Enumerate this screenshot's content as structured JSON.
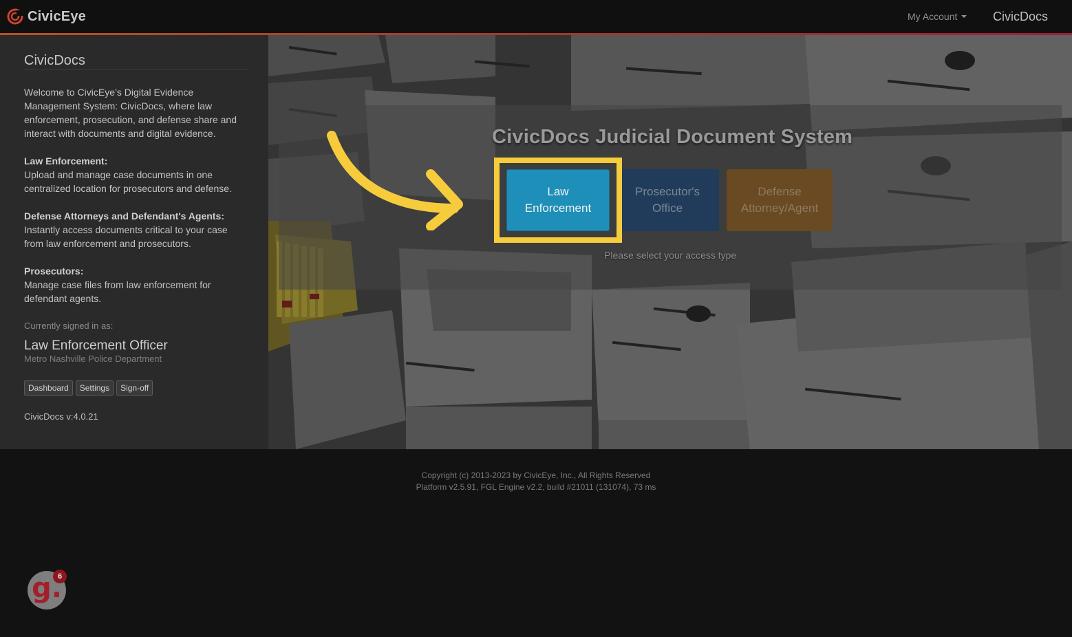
{
  "navbar": {
    "brand": "CivicEye",
    "account_menu": "My Account",
    "app_name": "CivicDocs"
  },
  "sidebar": {
    "title": "CivicDocs",
    "welcome": "Welcome to CivicEye’s Digital Evidence Management System: CivicDocs, where law enforcement, prosecution, and defense share and interact with documents and digital evidence.",
    "sections": [
      {
        "heading": "Law Enforcement:",
        "text": "Upload and manage case documents in one centralized location for prosecutors and defense."
      },
      {
        "heading": "Defense Attorneys and Defendant's Agents:",
        "text": "Instantly access documents critical to your case from law enforcement and prosecutors."
      },
      {
        "heading": "Prosecutors:",
        "text": "Manage case files from law enforcement for defendant agents."
      }
    ],
    "signed_in_label": "Currently signed in as:",
    "user_role": "Law Enforcement Officer",
    "user_department": "Metro Nashville Police Department",
    "buttons": {
      "dashboard": "Dashboard",
      "settings": "Settings",
      "signoff": "Sign-off"
    },
    "version": "CivicDocs v:4.0.21"
  },
  "hero": {
    "title": "CivicDocs Judicial Document System",
    "access_buttons": {
      "law": {
        "line1": "Law",
        "line2": "Enforcement"
      },
      "prosecutor": {
        "line1": "Prosecutor's",
        "line2": "Office"
      },
      "defense": {
        "line1": "Defense",
        "line2": "Attorney/Agent"
      }
    },
    "hint": "Please select your access type"
  },
  "footer": {
    "copyright": "Copyright (c) 2013-2023 by CivicEye, Inc., All Rights Reserved",
    "platform": "Platform v2.5.91, FGL Engine v2.2, build #21011 (131074), 73 ms"
  },
  "badge": {
    "letter": "g.",
    "count": "6"
  },
  "colors": {
    "accent_law": "#1e8fb8",
    "accent_prosecutor": "#203c5a",
    "accent_defense": "#6a4a22",
    "highlight": "#f6cc3c",
    "brand_red": "#c0392b"
  }
}
